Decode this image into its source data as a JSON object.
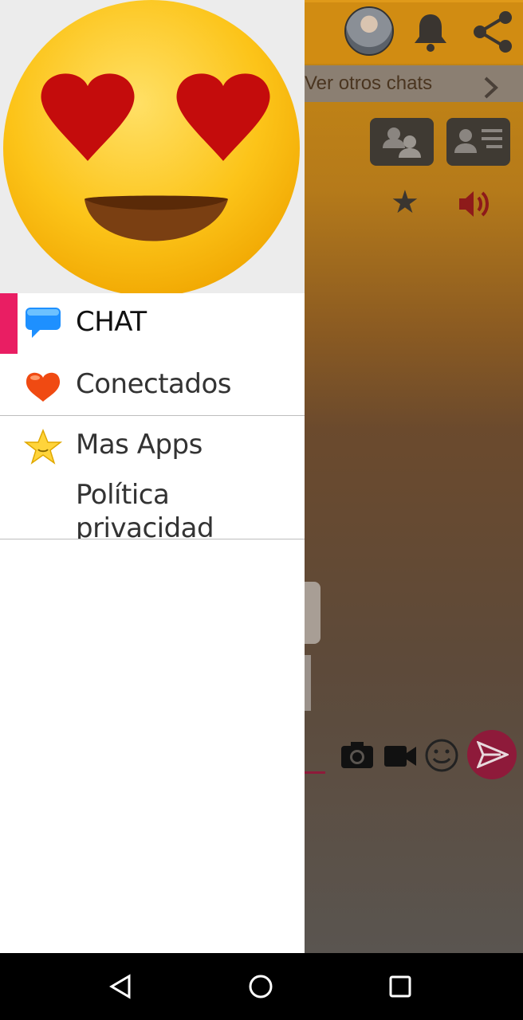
{
  "app": {
    "other_chats_label": "Ver otros chats"
  },
  "drawer": {
    "items": [
      {
        "label": "CHAT",
        "icon": "chat-bubble-icon",
        "active": true
      },
      {
        "label": "Conectados",
        "icon": "heart-icon"
      },
      {
        "label": "Mas Apps",
        "icon": "star-icon"
      },
      {
        "label": "Política privacidad",
        "icon": ""
      }
    ]
  },
  "colors": {
    "accent": "#e91e63",
    "app_bar": "#d18c12",
    "send_button": "#8e1a3a"
  }
}
